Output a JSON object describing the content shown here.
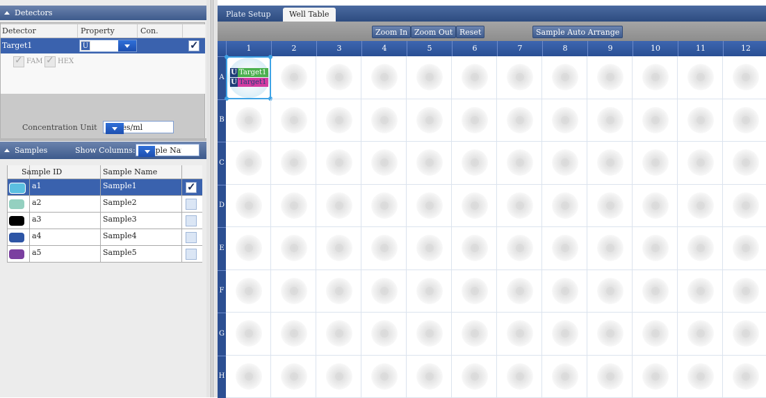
{
  "detectors": {
    "title": "Detectors",
    "columns": {
      "detector": "Detector",
      "property": "Property",
      "con": "Con."
    },
    "row": {
      "name": "Target1",
      "property": "U",
      "checked": true
    },
    "dyes": [
      "FAM",
      "HEX"
    ],
    "concentration_label": "Concentration Unit",
    "concentration_value": "copies/ml"
  },
  "samples": {
    "title": "Samples",
    "show_columns_label": "Show Columns:",
    "show_columns_value": "Sample Name",
    "columns": {
      "id": "Sample ID",
      "name": "Sample Name"
    },
    "rows": [
      {
        "id": "a1",
        "name": "Sample1",
        "color": "#5bbfe0",
        "selected": true,
        "checked": true
      },
      {
        "id": "a2",
        "name": "Sample2",
        "color": "#94d0c0",
        "selected": false,
        "checked": false
      },
      {
        "id": "a3",
        "name": "Sample3",
        "color": "#000000",
        "selected": false,
        "checked": false
      },
      {
        "id": "a4",
        "name": "Sample4",
        "color": "#2d55a5",
        "selected": false,
        "checked": false
      },
      {
        "id": "a5",
        "name": "Sample5",
        "color": "#7b3fa0",
        "selected": false,
        "checked": false
      }
    ]
  },
  "tabs": {
    "plate_setup": "Plate Setup",
    "well_table": "Well Table",
    "active": "Well Table"
  },
  "toolbar": {
    "zoom_in": "Zoom In",
    "zoom_out": "Zoom Out",
    "reset": "Reset",
    "auto_arrange": "Sample Auto Arrange"
  },
  "plate": {
    "columns": [
      "1",
      "2",
      "3",
      "4",
      "5",
      "6",
      "7",
      "8",
      "9",
      "10",
      "11",
      "12"
    ],
    "rows": [
      "A",
      "B",
      "C",
      "D",
      "E",
      "F",
      "G",
      "H"
    ],
    "active_well": {
      "row": "A",
      "col": "1",
      "targets": [
        {
          "prefix": "U",
          "label": "Target1",
          "color": "#4bb04f",
          "text_color": "#ffffff"
        },
        {
          "prefix": "U",
          "label": "Target1",
          "color": "#d23ca0",
          "text_color": "#1e3d78"
        }
      ]
    }
  },
  "colors": {
    "header_blue": "#3a62ae",
    "selection_blue": "#3a62ae",
    "well_highlight": "#3ea3e6"
  }
}
